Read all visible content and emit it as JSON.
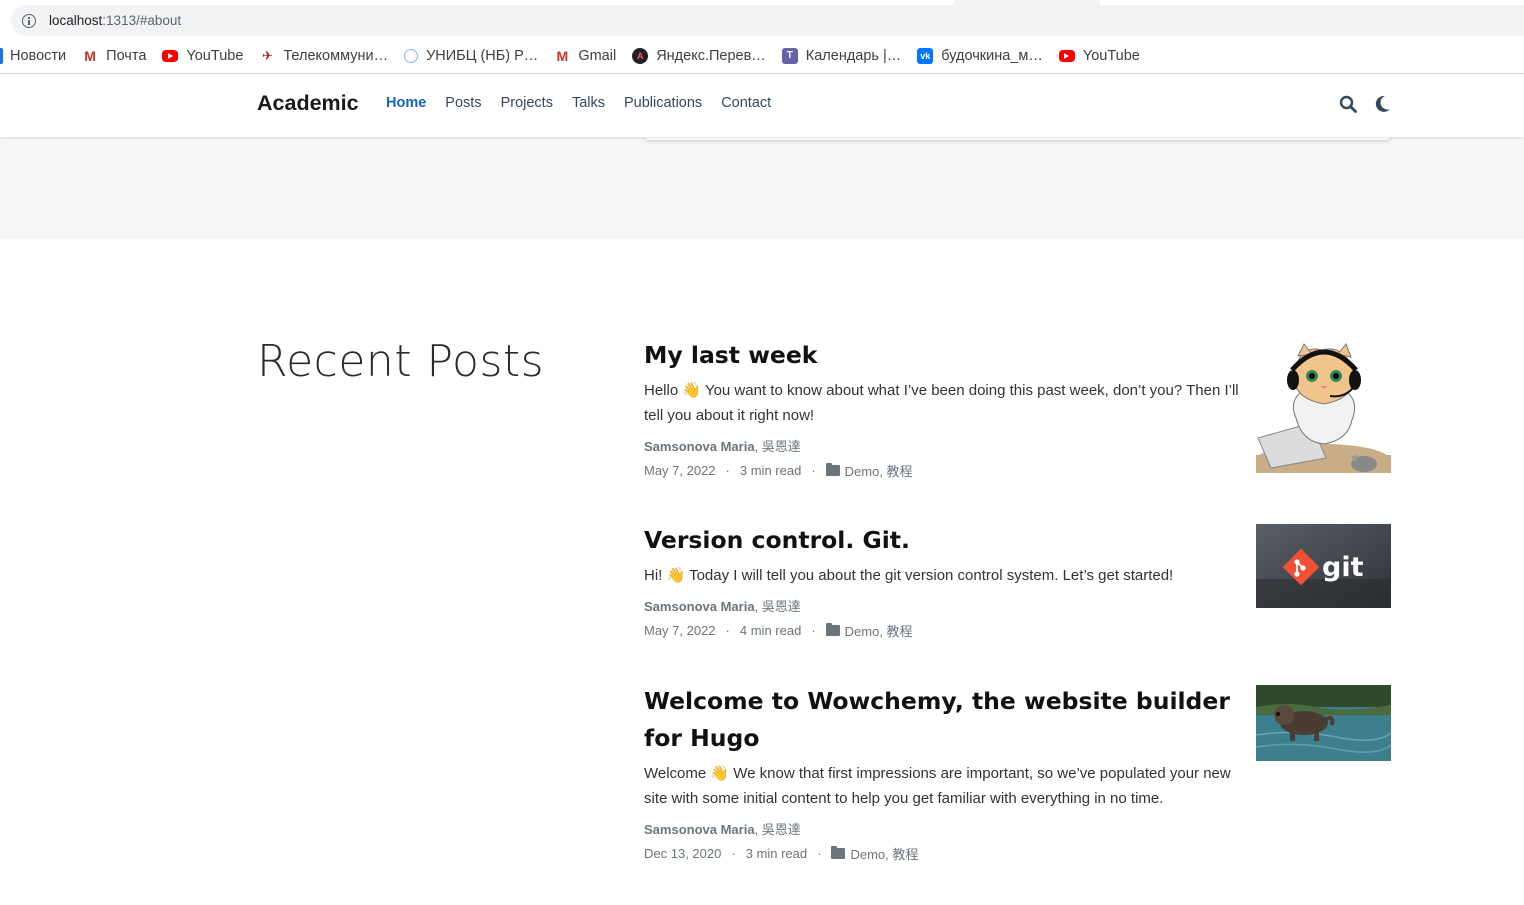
{
  "browser": {
    "url_host": "localhost",
    "url_rest": ":1313/#about",
    "bookmarks": [
      {
        "label": "Новости",
        "icon": "bookmark-bar-icon"
      },
      {
        "label": "Почта",
        "icon": "mail-icon"
      },
      {
        "label": "YouTube",
        "icon": "youtube-icon"
      },
      {
        "label": "Телекоммуни…",
        "icon": "telecom-icon"
      },
      {
        "label": "УНИБЦ (НБ) Р…",
        "icon": "unibc-icon"
      },
      {
        "label": "Gmail",
        "icon": "gmail-icon"
      },
      {
        "label": "Яндекс.Перев…",
        "icon": "yandex-translate-icon"
      },
      {
        "label": "Календарь |…",
        "icon": "teams-icon"
      },
      {
        "label": "будочкина_м…",
        "icon": "vk-icon"
      },
      {
        "label": "YouTube",
        "icon": "youtube-icon"
      }
    ]
  },
  "nav": {
    "brand": "Academic",
    "items": [
      "Home",
      "Posts",
      "Projects",
      "Talks",
      "Publications",
      "Contact"
    ],
    "active": "Home"
  },
  "section": {
    "title": "Recent Posts"
  },
  "posts": [
    {
      "title": "My last week",
      "summary_a": "Hello ",
      "emoji": "👋",
      "summary_b": " You want to know about what I’ve been doing this past week, don’t you? Then I’ll tell you about it right now!",
      "author_main": "Samsonova Maria",
      "author_rest": ", 吳恩達",
      "date": "May 7, 2022",
      "read": "3 min read",
      "categories": "Demo, 教程",
      "thumb": "kitten-headset-laptop-image"
    },
    {
      "title": "Version control. Git.",
      "summary_a": "Hi! ",
      "emoji": "👋",
      "summary_b": " Today I will tell you about the git version control system. Let’s get started!",
      "author_main": "Samsonova Maria",
      "author_rest": ", 吳恩達",
      "date": "May 7, 2022",
      "read": "4 min read",
      "categories": "Demo, 教程",
      "thumb": "git-logo-image",
      "thumb_text": "git"
    },
    {
      "title": "Welcome to Wowchemy, the website builder for Hugo",
      "summary_a": "Welcome ",
      "emoji": "👋",
      "summary_b": " We know that first impressions are important, so we’ve populated your new site with some initial content to help you get familiar with everything in no time.",
      "author_main": "Samsonova Maria",
      "author_rest": ", 吳恩達",
      "date": "Dec 13, 2020",
      "read": "3 min read",
      "categories": "Demo, 教程",
      "thumb": "dog-in-water-image"
    }
  ],
  "colors": {
    "accent": "#1565c0",
    "text": "#111111",
    "muted": "#6c757d",
    "hero_bg": "#f7f7f7"
  }
}
